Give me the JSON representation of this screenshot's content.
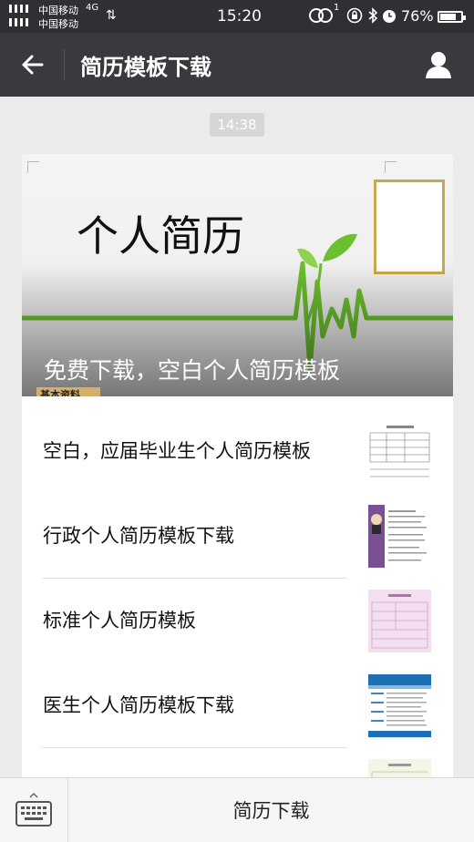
{
  "status_bar": {
    "carrier_1": "中国移动",
    "network_type": "4G",
    "carrier_2": "中国移动",
    "time": "15:20",
    "hd_call_badge": "1",
    "battery_percent": "76%",
    "battery_level": 0.76,
    "icons": [
      "signal-bars-icon",
      "data-arrows-icon",
      "hd-voice-icon",
      "lock-rotation-icon",
      "bluetooth-icon",
      "alarm-icon",
      "battery-icon"
    ]
  },
  "header": {
    "title": "简历模板下载",
    "back_icon": "back-arrow-icon",
    "profile_icon": "person-icon"
  },
  "chat": {
    "timestamp": "14:38",
    "card": {
      "cover": {
        "heading": "个人简历",
        "tag": "基本资料",
        "caption": "免费下载，空白个人简历模板"
      },
      "articles": [
        {
          "title": "空白，应届毕业生个人简历模板"
        },
        {
          "title": "行政个人简历模板下载"
        },
        {
          "title": "标准个人简历模板"
        },
        {
          "title": "医生个人简历模板下载"
        }
      ]
    }
  },
  "bottom_bar": {
    "keyboard_icon": "keyboard-icon",
    "menu_label": "简历下载"
  },
  "colors": {
    "status_bar": "#2e3033",
    "title_bar": "#393a3e",
    "background": "#ebebeb",
    "ekg_green": "#6cbf2e",
    "photo_frame_gold": "#c9a94b"
  }
}
